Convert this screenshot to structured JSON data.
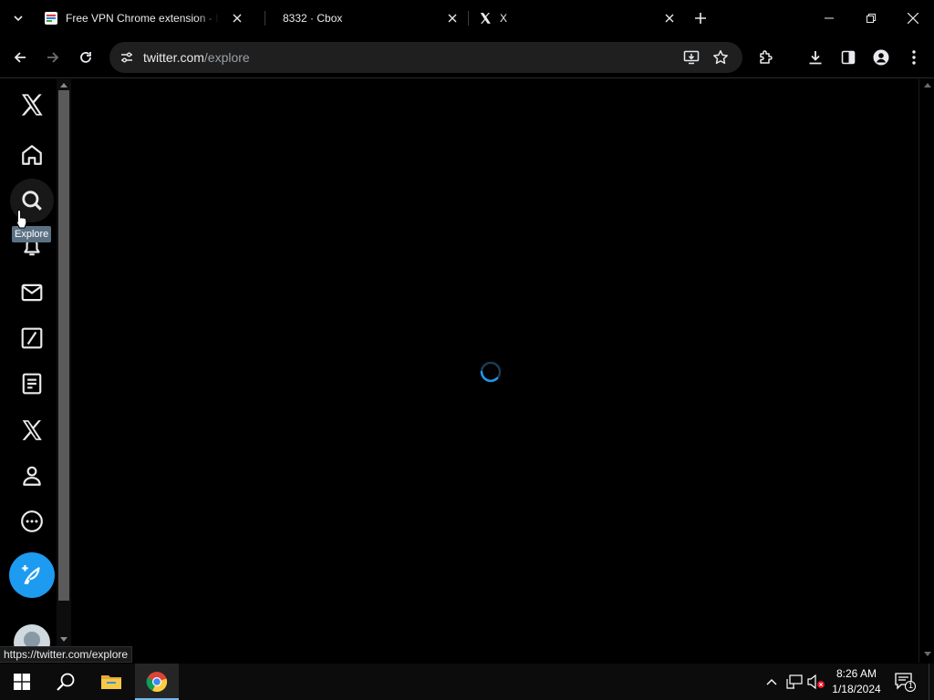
{
  "browser": {
    "tabs": [
      {
        "title": "Free VPN Chrome extension - B",
        "favicon": "vpn-favicon"
      },
      {
        "title": "8332 · Cbox",
        "favicon": "none"
      },
      {
        "title": "X",
        "favicon": "x-logo-icon"
      }
    ],
    "url_host": "twitter.com",
    "url_path": "/explore",
    "status_url": "https://twitter.com/explore"
  },
  "sidebar": {
    "items": [
      "x-logo-icon",
      "home-icon",
      "search-icon",
      "bell-icon",
      "mail-icon",
      "grok-icon",
      "lists-icon",
      "x-premium-icon",
      "profile-icon",
      "more-icon"
    ],
    "tooltip": "Explore"
  },
  "colors": {
    "accent": "#1d9bf0",
    "background": "#000000"
  },
  "taskbar": {
    "time": "8:26 AM",
    "date": "1/18/2024",
    "notification_count": "1"
  }
}
